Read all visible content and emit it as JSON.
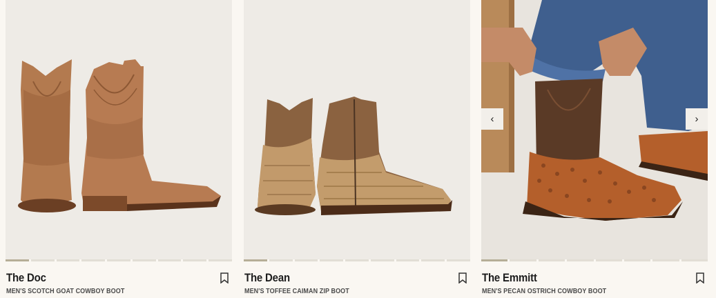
{
  "products": [
    {
      "name": "The Doc",
      "subtitle": "MEN'S SCOTCH GOAT COWBOY BOOT",
      "image_count": 9,
      "active_image": 1
    },
    {
      "name": "The Dean",
      "subtitle": "MEN'S TOFFEE CAIMAN ZIP BOOT",
      "image_count": 9,
      "active_image": 1
    },
    {
      "name": "The Emmitt",
      "subtitle": "MEN'S PECAN OSTRICH COWBOY BOOT",
      "image_count": 8,
      "active_image": 1
    }
  ],
  "carousel": {
    "prev_icon": "chevron-left-icon",
    "next_icon": "chevron-right-icon",
    "prev_glyph": "‹",
    "next_glyph": "›"
  },
  "icons": {
    "bookmark": "bookmark-icon"
  },
  "colors": {
    "page_bg": "#faf7f2",
    "image_bg": "#eeebe6",
    "progress_active": "#b6ae97",
    "progress_inactive": "#e2ded5"
  }
}
